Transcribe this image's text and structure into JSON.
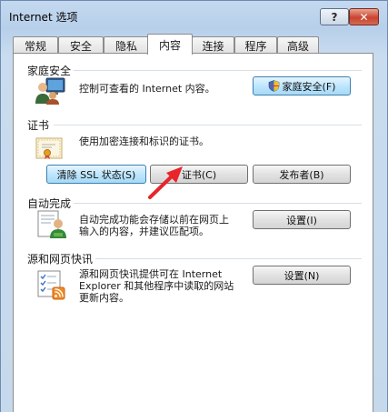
{
  "window": {
    "title": "Internet 选项"
  },
  "caption": {
    "help": "?",
    "close": "✕"
  },
  "tabs": [
    {
      "label": "常规"
    },
    {
      "label": "安全"
    },
    {
      "label": "隐私"
    },
    {
      "label": "内容"
    },
    {
      "label": "连接"
    },
    {
      "label": "程序"
    },
    {
      "label": "高级"
    }
  ],
  "family_safety": {
    "title": "家庭安全",
    "description": "控制可查看的 Internet 内容。",
    "button": "家庭安全(F)"
  },
  "certificates": {
    "title": "证书",
    "description": "使用加密连接和标识的证书。",
    "clear_ssl_button": "清除 SSL 状态(S)",
    "certificates_button": "证书(C)",
    "publishers_button": "发布者(B)"
  },
  "autocomplete": {
    "title": "自动完成",
    "description_line1": "自动完成功能会存储以前在网页上",
    "description_line2": "输入的内容，并建议匹配项。",
    "settings_button": "设置(I)"
  },
  "feeds": {
    "title": "源和网页快讯",
    "description_line1": "源和网页快讯提供可在 Internet",
    "description_line2": "Explorer 和其他程序中读取的网站",
    "description_line3": "更新内容。",
    "settings_button": "设置(N)"
  }
}
